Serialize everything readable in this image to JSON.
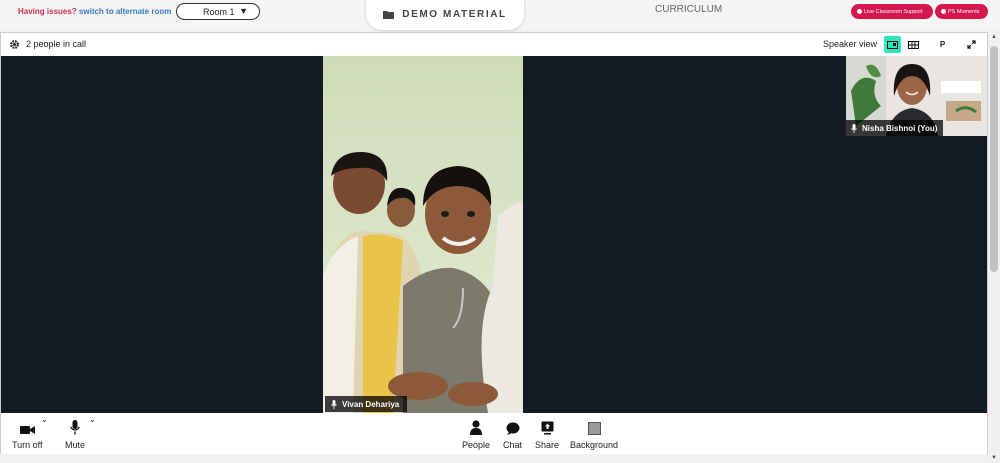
{
  "header": {
    "issue_text": "Having issues?",
    "alternate_link": "switch to alternate room",
    "room_select": "Room 1",
    "demo_material": "DEMO MATERIAL",
    "curriculum": "CURRICULUM",
    "support_button": "Live Classroom Support",
    "moments_button": "PS Moments"
  },
  "call": {
    "people_count": "2 people in call",
    "view_label": "Speaker view",
    "pin_button": "P",
    "main_participant": "Vivan Dehariya",
    "self_participant": "Nisha Bishnoi (You)"
  },
  "toolbar": {
    "camera": "Turn off",
    "mute": "Mute",
    "people": "People",
    "chat": "Chat",
    "share": "Share",
    "background": "Background"
  },
  "colors": {
    "accent_red": "#d4184f",
    "active_view": "#2ee6b8",
    "stage_bg": "#121a23"
  }
}
